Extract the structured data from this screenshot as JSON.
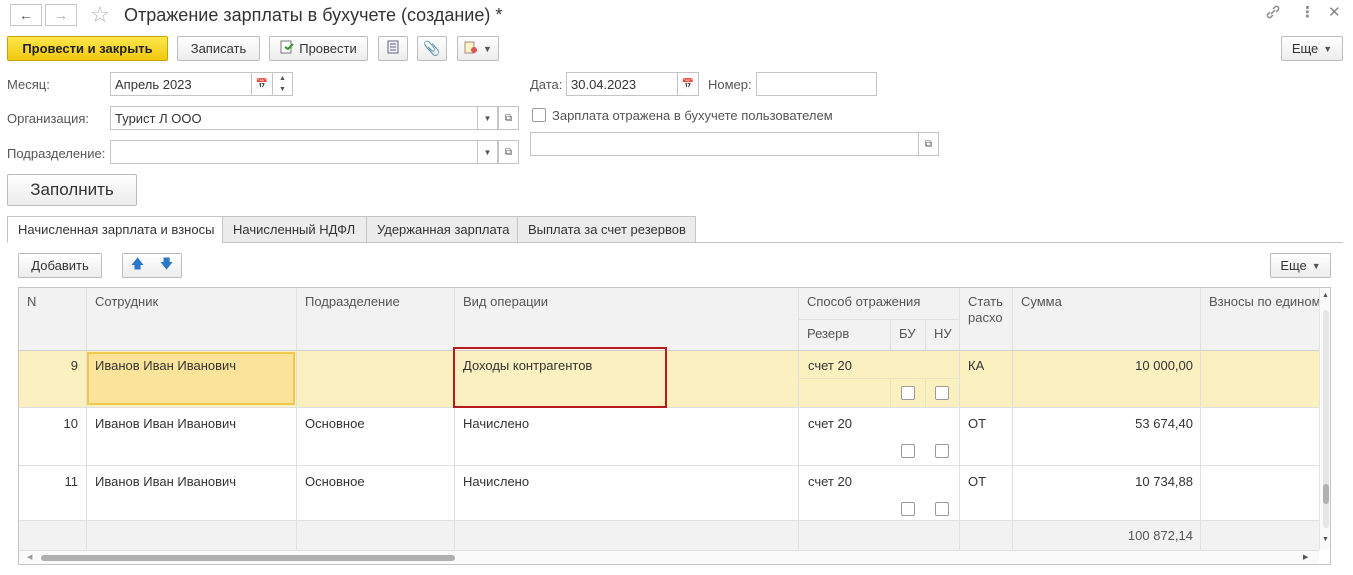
{
  "window": {
    "title": "Отражение зарплаты в бухучете (создание) *"
  },
  "toolbar": {
    "post_close": "Провести и закрыть",
    "save": "Записать",
    "post": "Провести",
    "more": "Еще"
  },
  "form": {
    "month_label": "Месяц:",
    "month_value": "Апрель 2023",
    "date_label": "Дата:",
    "date_value": "30.04.2023",
    "number_label": "Номер:",
    "number_value": "",
    "org_label": "Организация:",
    "org_value": "Турист Л ООО",
    "dept_label": "Подразделение:",
    "dept_value": "",
    "reflected_label": "Зарплата отражена в бухучете пользователем",
    "reflected_checked": false,
    "user_value": "",
    "fill_button": "Заполнить"
  },
  "tabs": [
    {
      "label": "Начисленная зарплата и взносы",
      "active": true
    },
    {
      "label": "Начисленный НДФЛ",
      "active": false
    },
    {
      "label": "Удержанная зарплата",
      "active": false
    },
    {
      "label": "Выплата за счет резервов",
      "active": false
    }
  ],
  "table_toolbar": {
    "add": "Добавить",
    "more": "Еще"
  },
  "table": {
    "columns": {
      "n": "N",
      "employee": "Сотрудник",
      "department": "Подразделение",
      "operation": "Вид операции",
      "method": "Способ отражения",
      "reserve": "Резерв",
      "bu": "БУ",
      "nu": "НУ",
      "article_1": "Стать",
      "article_2": "расхо",
      "amount": "Сумма",
      "contributions": "Взносы по едином"
    },
    "rows": [
      {
        "n": "9",
        "employee": "Иванов Иван Иванович",
        "department": "",
        "operation": "Доходы контрагентов",
        "method": "счет 20",
        "bu": false,
        "nu": false,
        "article": "КА",
        "amount": "10 000,00",
        "selected": true
      },
      {
        "n": "10",
        "employee": "Иванов Иван Иванович",
        "department": "Основное",
        "operation": "Начислено",
        "method": "счет 20",
        "bu": false,
        "nu": false,
        "article": "ОТ",
        "amount": "53 674,40",
        "selected": false
      },
      {
        "n": "11",
        "employee": "Иванов Иван Иванович",
        "department": "Основное",
        "operation": "Начислено",
        "method": "счет 20",
        "bu": false,
        "nu": false,
        "article": "ОТ",
        "amount": "10 734,88",
        "selected": false
      }
    ],
    "total_amount": "100 872,14"
  },
  "colors": {
    "primary_button": "#f5d32a",
    "selected_row": "#fbf0c0",
    "selected_cell": "#fbe49a",
    "highlight_border": "#b81c1c"
  }
}
